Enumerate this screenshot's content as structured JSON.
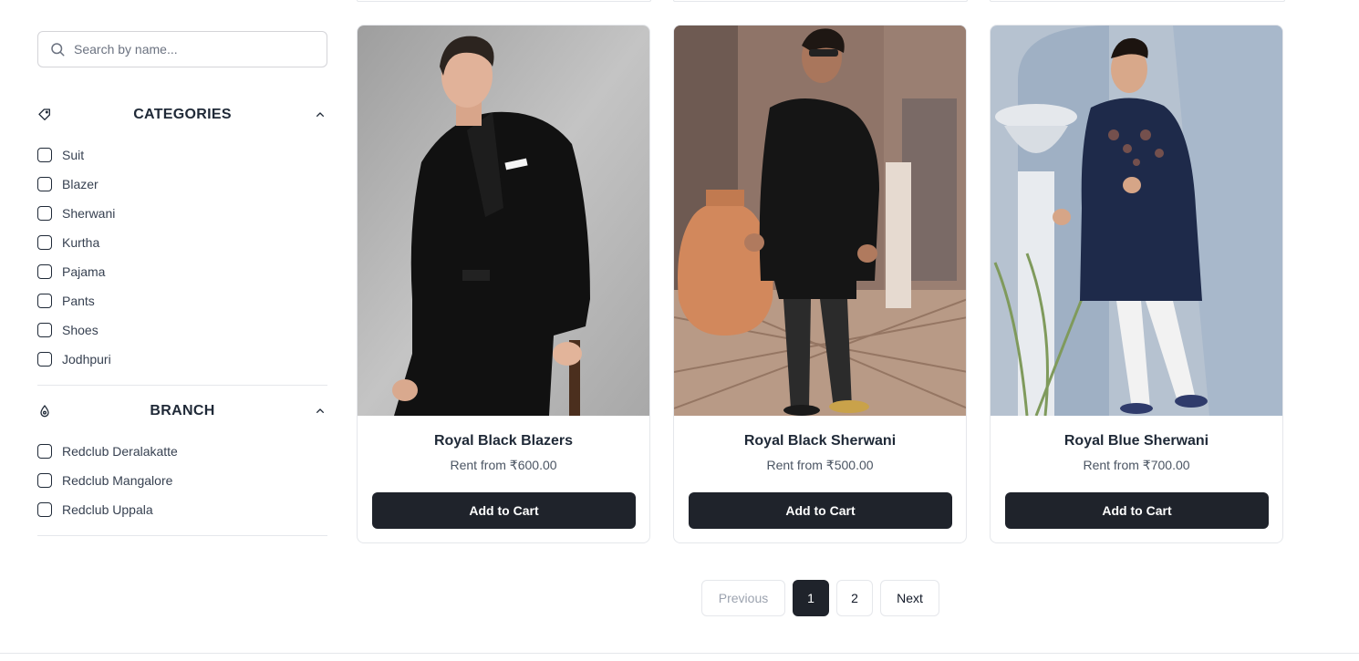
{
  "search": {
    "placeholder": "Search by name..."
  },
  "filters": {
    "categories": {
      "title": "CATEGORIES",
      "items": [
        "Suit",
        "Blazer",
        "Sherwani",
        "Kurtha",
        "Pajama",
        "Pants",
        "Shoes",
        "Jodhpuri"
      ]
    },
    "branch": {
      "title": "BRANCH",
      "items": [
        "Redclub Deralakatte",
        "Redclub Mangalore",
        "Redclub Uppala"
      ]
    }
  },
  "products": [
    {
      "name": "Royal Black Blazers",
      "price": "Rent from ₹600.00",
      "button": "Add to Cart"
    },
    {
      "name": "Royal Black Sherwani",
      "price": "Rent from ₹500.00",
      "button": "Add to Cart"
    },
    {
      "name": "Royal Blue Sherwani",
      "price": "Rent from ₹700.00",
      "button": "Add to Cart"
    }
  ],
  "pagination": {
    "previous": "Previous",
    "pages": [
      "1",
      "2"
    ],
    "current": "1",
    "next": "Next"
  },
  "colors": {
    "primary_button": "#1f232b",
    "border": "#e5e7eb",
    "text": "#1f2937"
  }
}
